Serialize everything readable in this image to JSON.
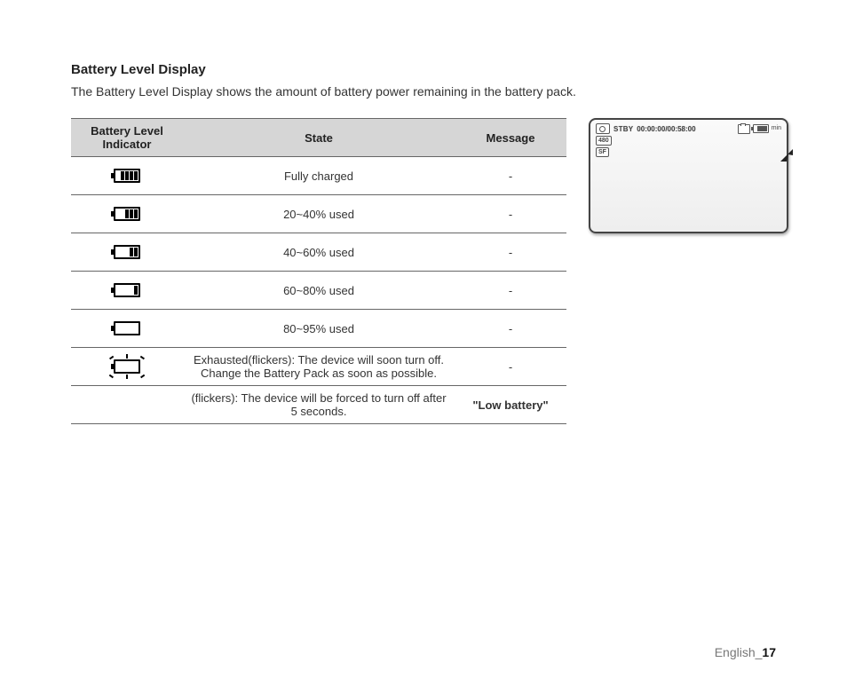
{
  "heading": "Battery Level Display",
  "description": "The Battery Level Display shows the amount of battery power remaining in the battery pack.",
  "headers": {
    "indicator": "Battery Level Indicator",
    "state": "State",
    "message": "Message"
  },
  "rows": {
    "r0": {
      "state": "Fully charged",
      "message": "-"
    },
    "r1": {
      "state": "20~40% used",
      "message": "-"
    },
    "r2": {
      "state": "40~60% used",
      "message": "-"
    },
    "r3": {
      "state": "60~80% used",
      "message": "-"
    },
    "r4": {
      "state": "80~95% used",
      "message": "-"
    },
    "r5": {
      "state": "Exhausted(flickers): The device will soon turn off. Change the Battery Pack as soon as possible.",
      "message": "-"
    },
    "r6": {
      "state": "(flickers): The device will be forced to turn off after 5 seconds.",
      "message": "\"Low battery\""
    }
  },
  "preview": {
    "stby": "STBY",
    "timecode": "00:00:00/00:58:00",
    "badge480": "480",
    "badgeSF": "SF",
    "minLabel": "min"
  },
  "footer": {
    "lang": "English_",
    "page": "17"
  }
}
